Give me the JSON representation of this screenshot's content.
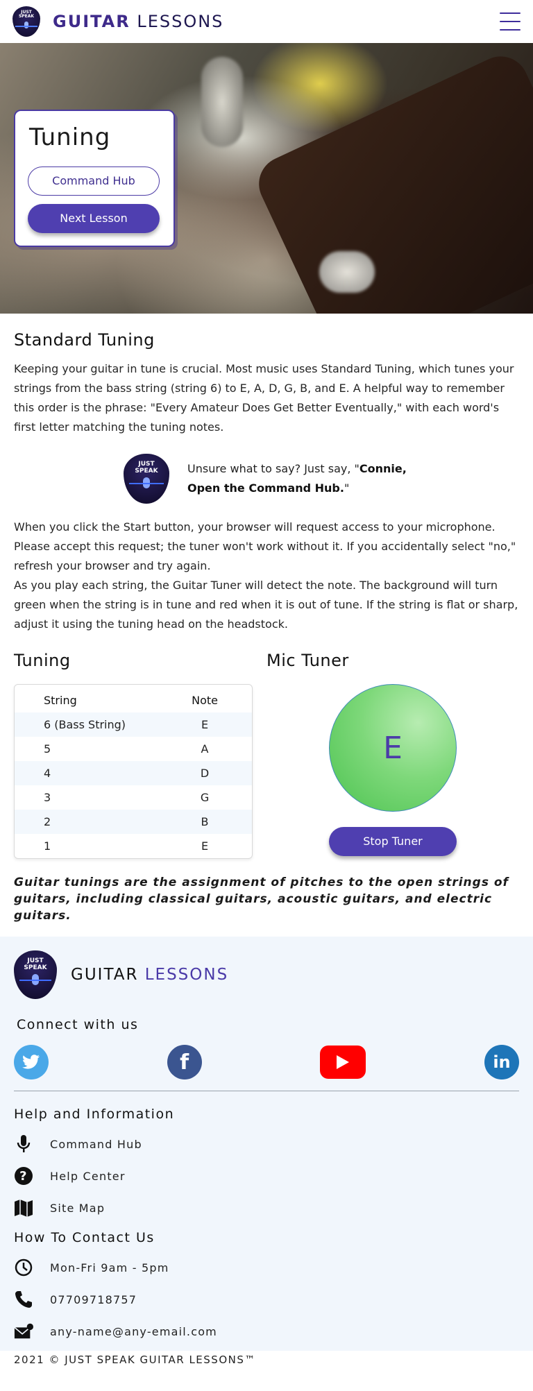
{
  "header": {
    "logo_line1": "JUST",
    "logo_line2": "SPEAK",
    "title_a": "GUITAR",
    "title_b": "LESSONS"
  },
  "hero": {
    "title": "Tuning",
    "command_hub_label": "Command Hub",
    "next_lesson_label": "Next Lesson"
  },
  "standard": {
    "heading": "Standard Tuning",
    "paragraph": "Keeping your guitar in tune is crucial. Most music uses Standard Tuning, which tunes your strings from the bass string (string 6) to E, A, D, G, B, and E. A helpful way to remember this order is the phrase: \"Every Amateur Does Get Better Eventually,\" with each word's first letter matching the tuning notes."
  },
  "tip": {
    "logo_line1": "JUST",
    "logo_line2": "SPEAK",
    "prefix": "Unsure what to say? Just say, \"",
    "command": "Connie, Open the Command Hub.",
    "suffix": "\""
  },
  "instructions": {
    "p1": "When you click the Start button, your browser will request access to your microphone. Please accept this request; the tuner won't work without it. If you accidentally select \"no,\" refresh your browser and try again.",
    "p2": "As you play each string, the Guitar Tuner will detect the note. The background will turn green when the string is in tune and red when it is out of tune. If the string is flat or sharp, adjust it using the tuning head on the headstock."
  },
  "tuning_table": {
    "heading": "Tuning",
    "columns": [
      "String",
      "Note"
    ],
    "rows": [
      [
        "6 (Bass String)",
        "E"
      ],
      [
        "5",
        "A"
      ],
      [
        "4",
        "D"
      ],
      [
        "3",
        "G"
      ],
      [
        "2",
        "B"
      ],
      [
        "1",
        "E"
      ]
    ]
  },
  "mic_tuner": {
    "heading": "Mic Tuner",
    "note": "E",
    "stop_label": "Stop Tuner",
    "status_color": "#4cc350"
  },
  "note_text": "Guitar tunings are the assignment of pitches to the open strings of guitars, including classical guitars, acoustic guitars, and electric guitars.",
  "footer": {
    "logo_line1": "JUST",
    "logo_line2": "SPEAK",
    "title_a": "GUITAR",
    "title_b": "LESSONS",
    "connect_heading": "Connect with us",
    "social": [
      {
        "name": "twitter-icon",
        "glyph": "🐦"
      },
      {
        "name": "facebook-icon",
        "glyph": "f"
      },
      {
        "name": "youtube-icon",
        "glyph": "▶"
      },
      {
        "name": "linkedin-icon",
        "glyph": "in"
      }
    ],
    "help_heading": "Help and Information",
    "help_links": [
      "Command Hub",
      "Help Center",
      "Site Map"
    ],
    "contact_heading": "How To Contact Us",
    "hours": "Mon-Fri 9am - 5pm",
    "phone": "07709718757",
    "email": "any-name@any-email.com",
    "copyright": "2021 © JUST SPEAK GUITAR LESSONS™"
  }
}
